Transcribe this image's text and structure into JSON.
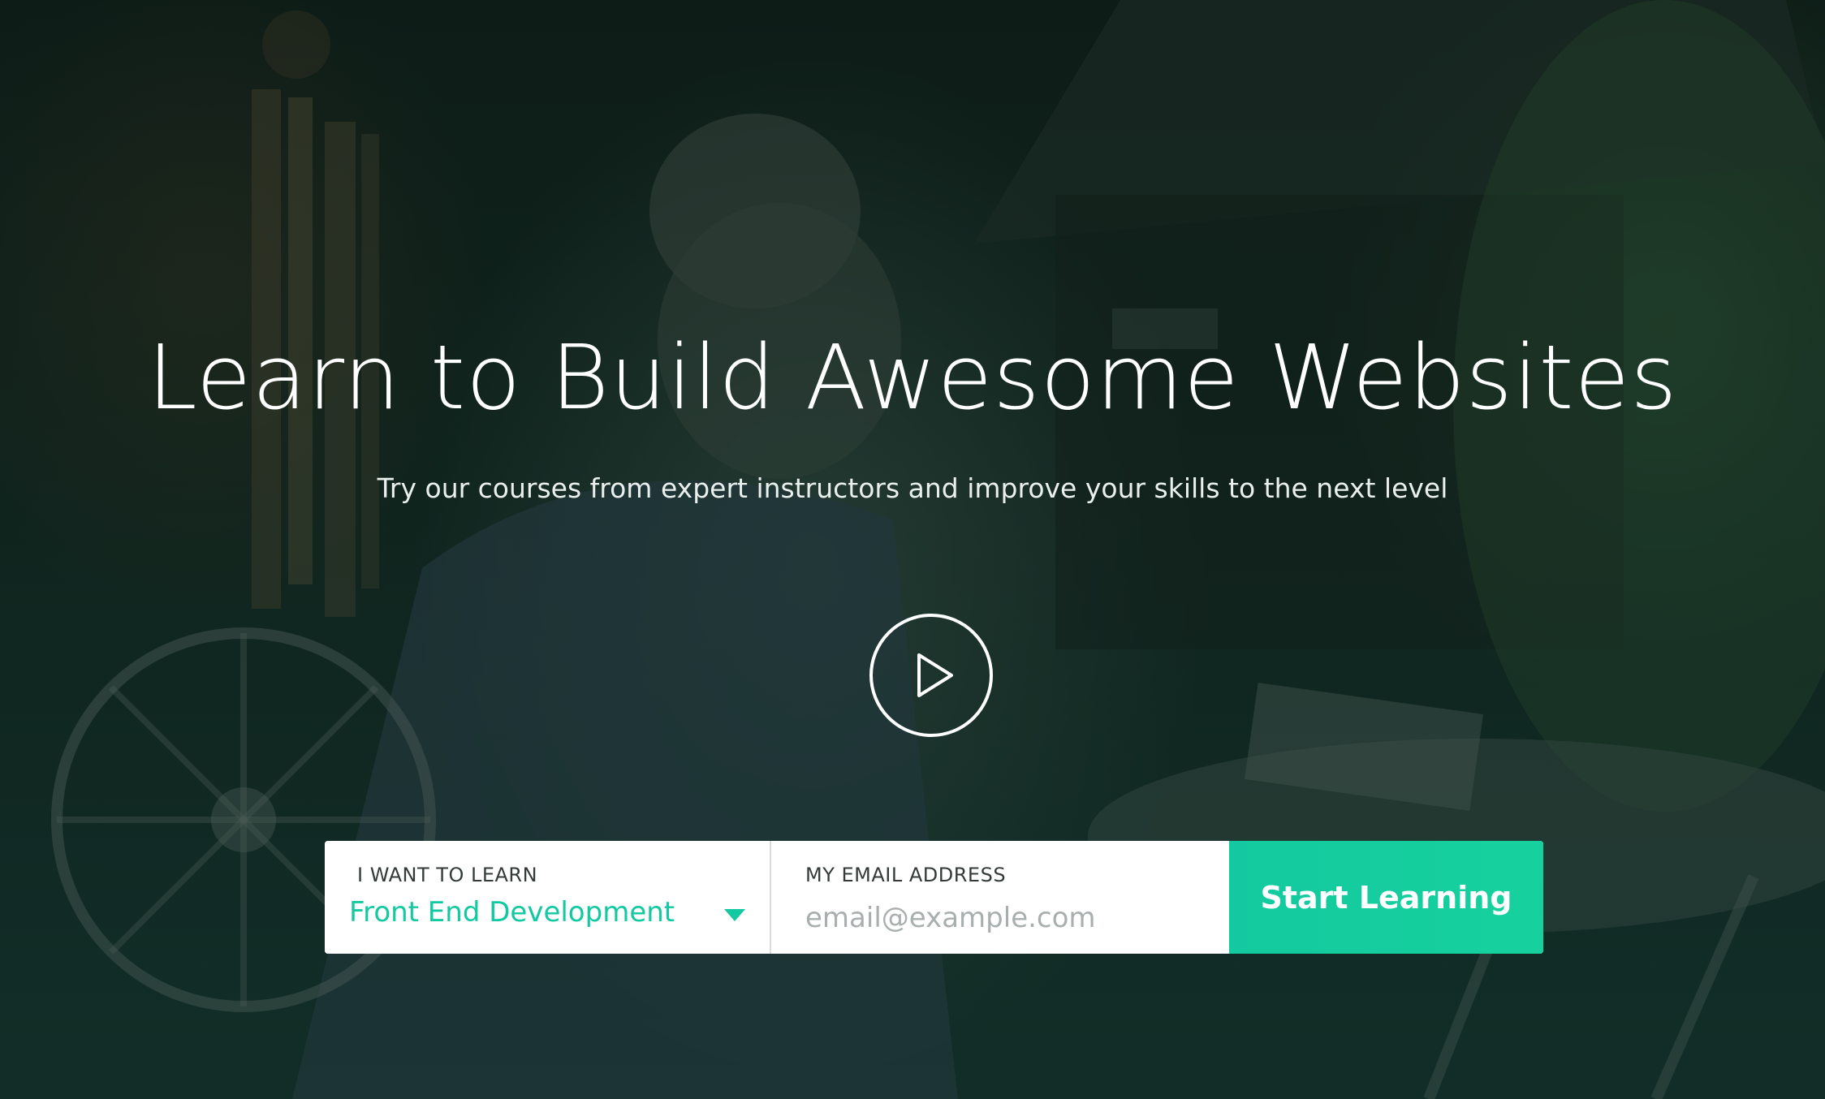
{
  "hero": {
    "title": "Learn to Build Awesome Websites",
    "subtitle": "Try our courses from expert instructors and improve your skills to the next level",
    "play_icon": "play-icon"
  },
  "form": {
    "learn_label": "I WANT TO LEARN",
    "learn_value": "Front End Development",
    "email_label": "MY EMAIL ADDRESS",
    "email_placeholder": "email@example.com",
    "email_value": "",
    "submit_label": "Start Learning"
  },
  "colors": {
    "accent": "#14c99f",
    "overlay": "#0f2a22",
    "text_light": "#ffffff"
  }
}
